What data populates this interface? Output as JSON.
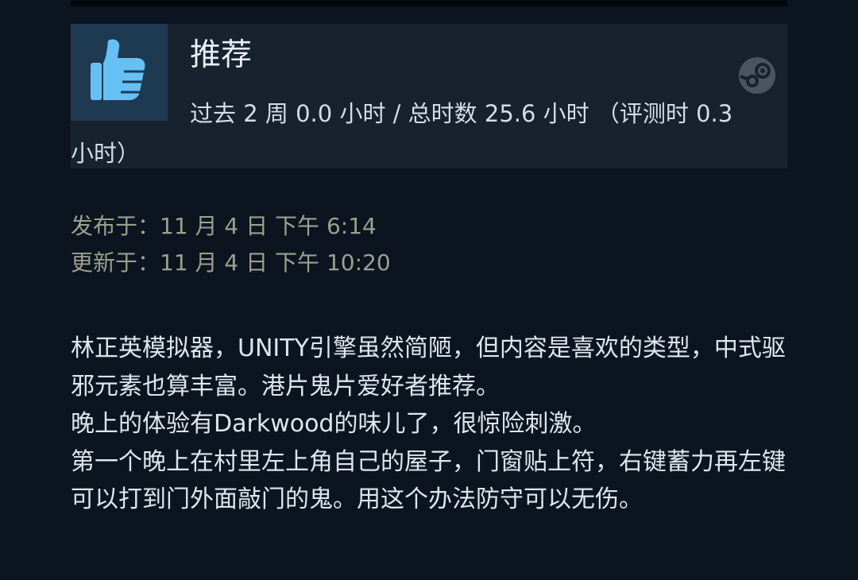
{
  "review": {
    "verdict": "推荐",
    "hours_line": "过去 2 周 0.0 小时 / 总时数 25.6 小时 （评测时 0.3 小时）",
    "posted": "发布于：11 月 4 日 下午 6:14",
    "updated": "更新于：11 月 4 日 下午 10:20",
    "paragraphs": [
      "林正英模拟器，UNITY引擎虽然简陋，但内容是喜欢的类型，中式驱邪元素也算丰富。港片鬼片爱好者推荐。",
      "晚上的体验有Darkwood的味儿了，很惊险刺激。",
      "第一个晚上在村里左上角自己的屋子，门窗贴上符，右键蓄力再左键可以打到门外面敲门的鬼。用这个办法防守可以无伤。"
    ]
  },
  "icons": {
    "thumb": "thumbs-up-icon",
    "platform": "steam-logo-icon"
  },
  "colors": {
    "background": "#0c1420",
    "header_background": "#17222e",
    "thumb_background": "#1d3a52",
    "thumb_icon": "#66c0f4",
    "date_text": "#9aa18f"
  }
}
